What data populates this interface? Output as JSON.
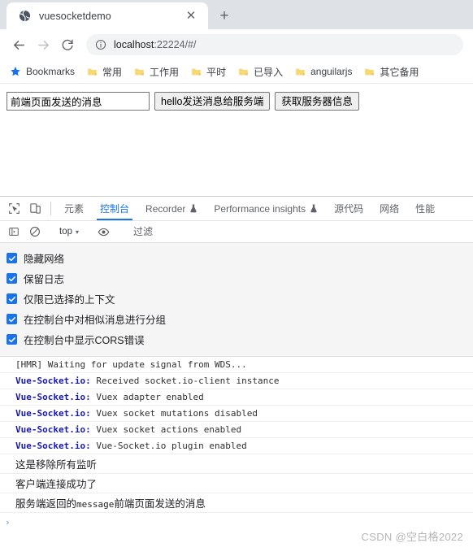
{
  "browser": {
    "tab": {
      "title": "vuesocketdemo",
      "favicon": "globe-icon",
      "close_label": "✕"
    },
    "new_tab_label": "+",
    "nav": {
      "back": "←",
      "forward": "→",
      "reload": "↻"
    },
    "omnibox": {
      "info_icon": "info-circle-icon",
      "url_host": "localhost",
      "url_rest": ":22224/#/"
    },
    "bookmarks": [
      {
        "label": "Bookmarks",
        "icon": "star-icon"
      },
      {
        "label": "常用",
        "icon": "folder-icon"
      },
      {
        "label": "工作用",
        "icon": "folder-icon"
      },
      {
        "label": "平时",
        "icon": "folder-icon"
      },
      {
        "label": "已导入",
        "icon": "folder-icon"
      },
      {
        "label": "anguilarjs",
        "icon": "folder-icon"
      },
      {
        "label": "其它备用",
        "icon": "folder-icon"
      }
    ]
  },
  "page": {
    "message_input_value": "前端页面发送的消息",
    "message_input_placeholder": "",
    "send_button": "hello发送消息给服务端",
    "fetch_button": "获取服务器信息"
  },
  "devtools": {
    "inspect_icon": "inspect-element-icon",
    "device_icon": "device-toolbar-icon",
    "tabs": [
      {
        "label": "元素",
        "active": false,
        "flask": false
      },
      {
        "label": "控制台",
        "active": true,
        "flask": false
      },
      {
        "label": "Recorder",
        "active": false,
        "flask": true
      },
      {
        "label": "Performance insights",
        "active": false,
        "flask": true
      },
      {
        "label": "源代码",
        "active": false,
        "flask": false
      },
      {
        "label": "网络",
        "active": false,
        "flask": false
      },
      {
        "label": "性能",
        "active": false,
        "flask": false
      }
    ],
    "toolbar": {
      "sidebar_icon": "console-sidebar-icon",
      "clear_icon": "clear-console-icon",
      "context_value": "top",
      "context_caret": "▾",
      "eye_icon": "live-expression-eye-icon",
      "filter_placeholder": "过滤",
      "filter_value": ""
    },
    "settings": [
      {
        "label": "隐藏网络",
        "checked": true
      },
      {
        "label": "保留日志",
        "checked": true
      },
      {
        "label": "仅限已选择的上下文",
        "checked": true
      },
      {
        "label": "在控制台中对相似消息进行分组",
        "checked": true
      },
      {
        "label": "在控制台中显示CORS错误",
        "checked": true
      }
    ],
    "logs": [
      {
        "style": "mono",
        "tag": "",
        "text": "[HMR] Waiting for update signal from WDS..."
      },
      {
        "style": "mono",
        "tag": "Vue-Socket.io:",
        "text": " Received socket.io-client instance"
      },
      {
        "style": "mono",
        "tag": "Vue-Socket.io:",
        "text": " Vuex adapter enabled"
      },
      {
        "style": "mono",
        "tag": "Vue-Socket.io:",
        "text": " Vuex socket mutations disabled"
      },
      {
        "style": "mono",
        "tag": "Vue-Socket.io:",
        "text": " Vuex socket actions enabled"
      },
      {
        "style": "mono",
        "tag": "Vue-Socket.io:",
        "text": " Vue-Socket.io plugin enabled"
      },
      {
        "style": "cjk",
        "tag": "",
        "text": "这是移除所有监听"
      },
      {
        "style": "cjk",
        "tag": "",
        "text": "客户端连接成功了"
      },
      {
        "style": "cjk-mixed",
        "pre": "服务端返回的",
        "mono": "message",
        "post": "前端页面发送的消息"
      }
    ],
    "prompt": "›"
  },
  "watermark": "CSDN @空白格2022",
  "colors": {
    "accent": "#1a73e8",
    "tabstrip_bg": "#dee1e6",
    "omnibox_bg": "#f1f3f4",
    "settings_bg": "#f5f5f5",
    "folder": "#f8d775",
    "log_tag": "#1a1aa8"
  }
}
